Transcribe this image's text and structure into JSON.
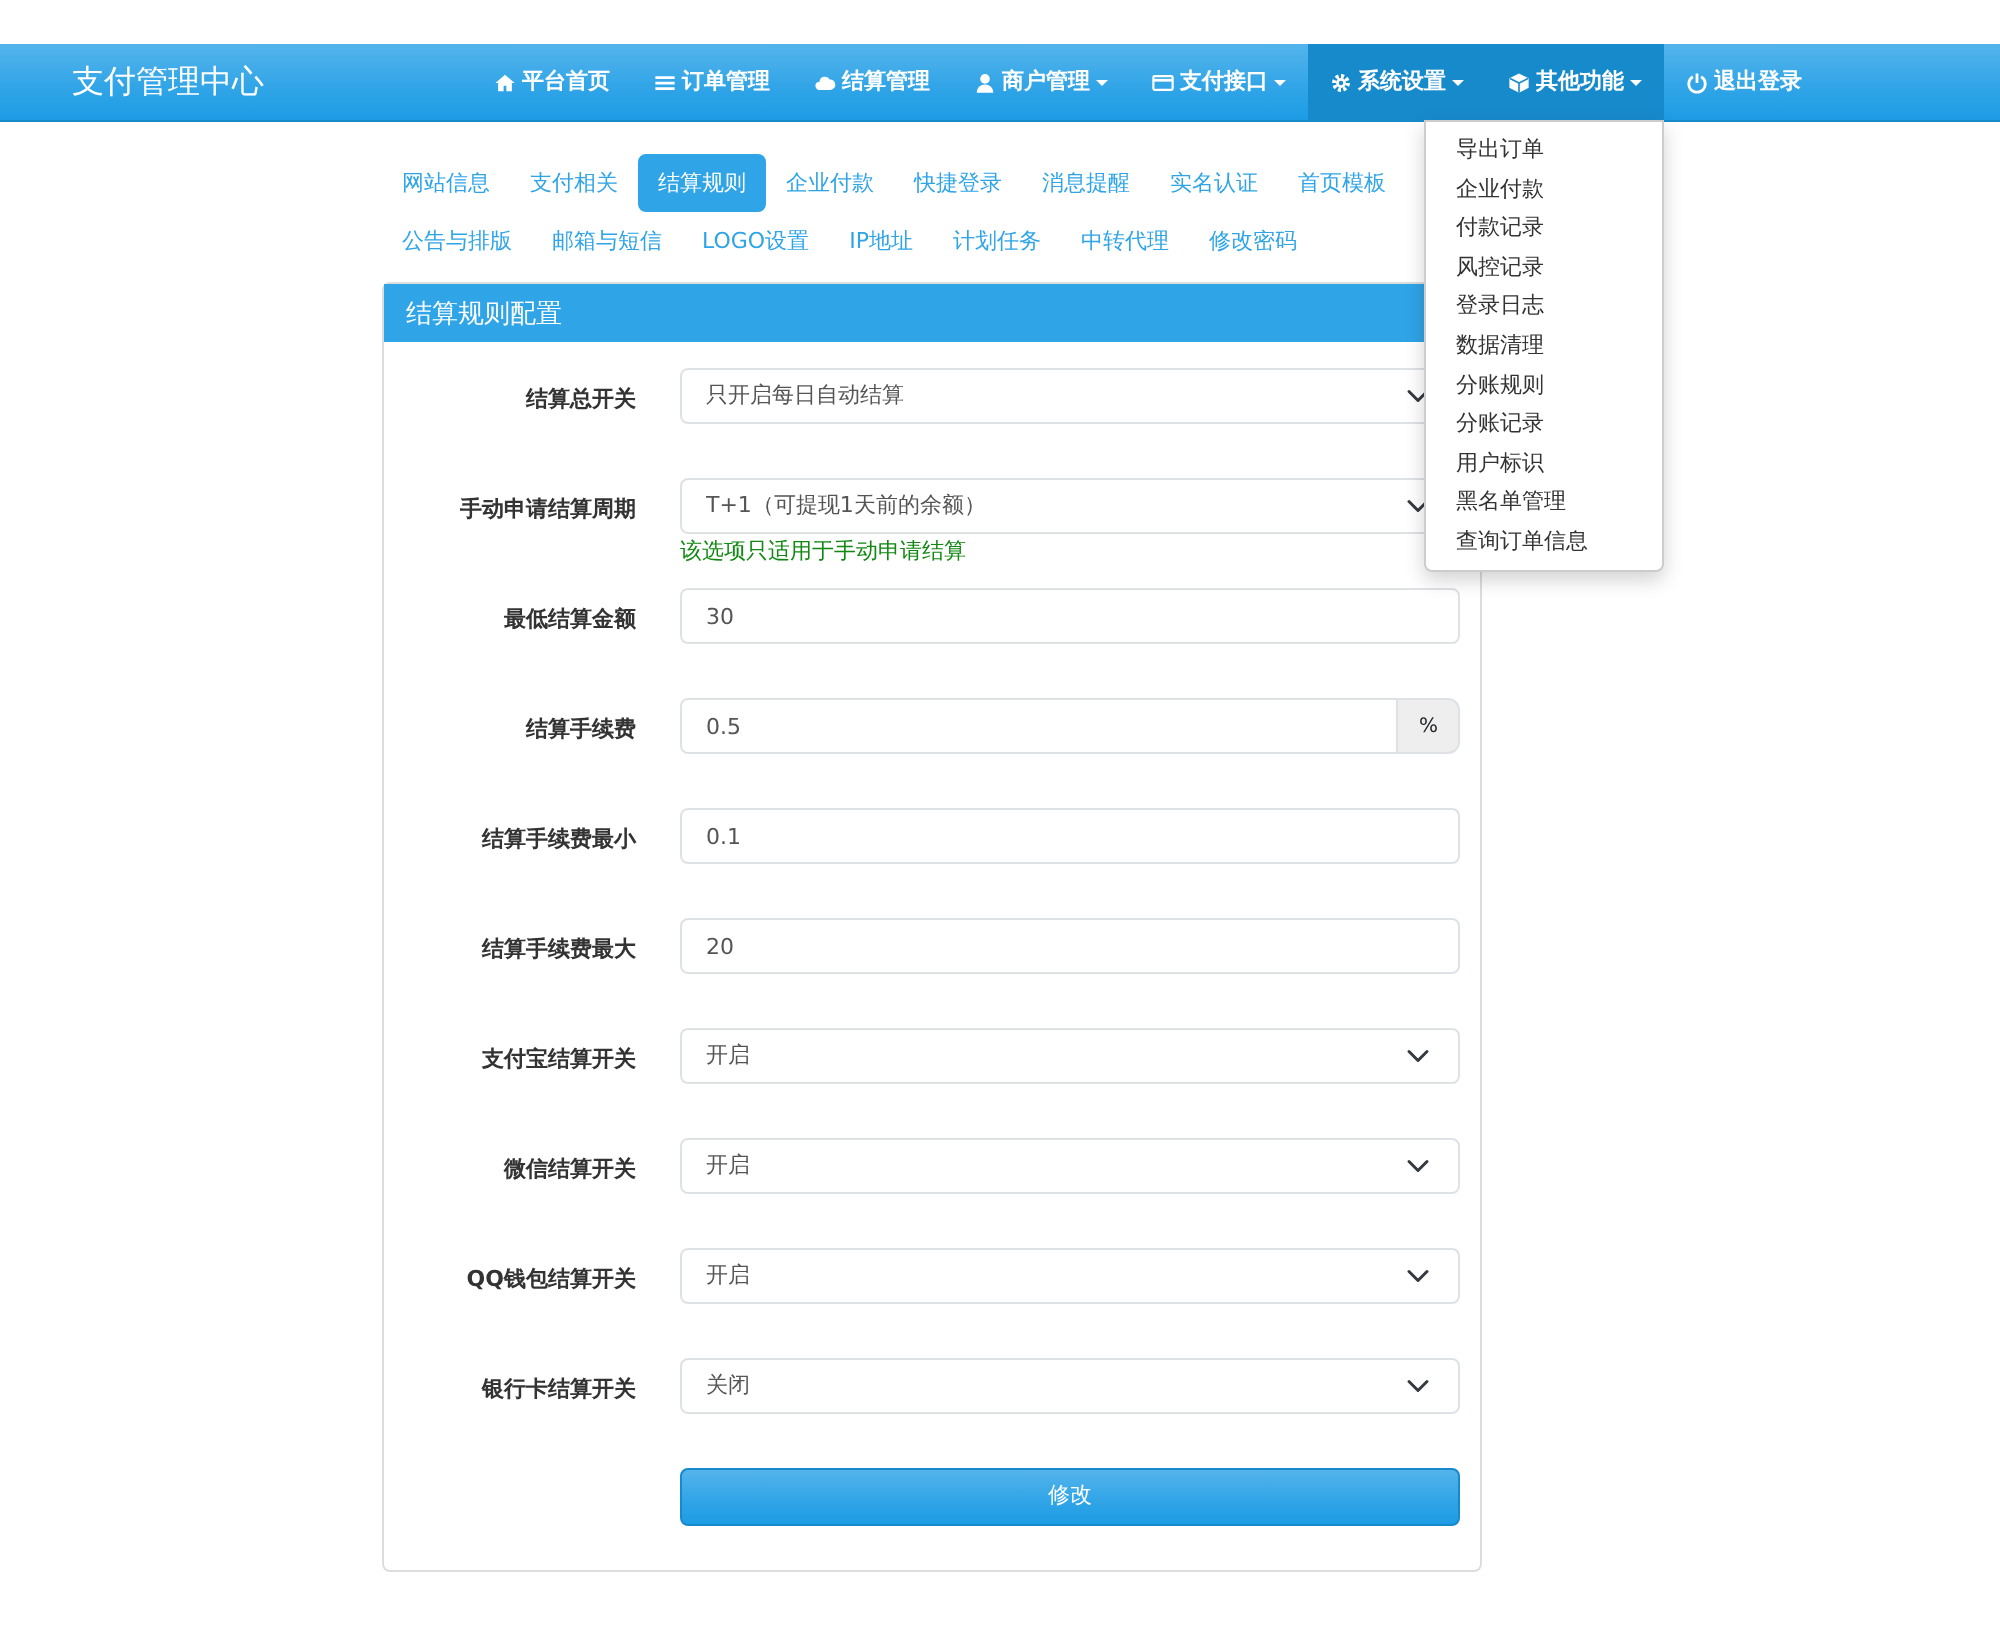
{
  "brand": "支付管理中心",
  "nav": [
    {
      "label": "平台首页",
      "dropdown": false,
      "active": false
    },
    {
      "label": "订单管理",
      "dropdown": false,
      "active": false
    },
    {
      "label": "结算管理",
      "dropdown": false,
      "active": false
    },
    {
      "label": "商户管理",
      "dropdown": true,
      "active": false
    },
    {
      "label": "支付接口",
      "dropdown": true,
      "active": false
    },
    {
      "label": "系统设置",
      "dropdown": true,
      "active": true
    },
    {
      "label": "其他功能",
      "dropdown": true,
      "active": true,
      "menu": [
        "导出订单",
        "企业付款",
        "付款记录",
        "风控记录",
        "登录日志",
        "数据清理",
        "分账规则",
        "分账记录",
        "用户标识",
        "黑名单管理",
        "查询订单信息"
      ]
    },
    {
      "label": "退出登录",
      "dropdown": false,
      "active": false
    }
  ],
  "tabs": [
    {
      "label": "网站信息",
      "selected": false
    },
    {
      "label": "支付相关",
      "selected": false
    },
    {
      "label": "结算规则",
      "selected": true
    },
    {
      "label": "企业付款",
      "selected": false
    },
    {
      "label": "快捷登录",
      "selected": false
    },
    {
      "label": "消息提醒",
      "selected": false
    },
    {
      "label": "实名认证",
      "selected": false
    },
    {
      "label": "首页模板",
      "selected": false
    },
    {
      "label": "公告与排版",
      "selected": false
    },
    {
      "label": "邮箱与短信",
      "selected": false
    },
    {
      "label": "LOGO设置",
      "selected": false
    },
    {
      "label": "IP地址",
      "selected": false
    },
    {
      "label": "计划任务",
      "selected": false
    },
    {
      "label": "中转代理",
      "selected": false
    },
    {
      "label": "修改密码",
      "selected": false
    }
  ],
  "panel": {
    "title": "结算规则配置",
    "fields": [
      {
        "kind": "select",
        "label": "结算总开关",
        "value": "只开启每日自动结算"
      },
      {
        "kind": "select",
        "label": "手动申请结算周期",
        "value": "T+1（可提现1天前的余额）",
        "help": "该选项只适用于手动申请结算"
      },
      {
        "kind": "input",
        "label": "最低结算金额",
        "value": "30"
      },
      {
        "kind": "addon",
        "label": "结算手续费",
        "value": "0.5",
        "addon": "%"
      },
      {
        "kind": "input",
        "label": "结算手续费最小",
        "value": "0.1"
      },
      {
        "kind": "input",
        "label": "结算手续费最大",
        "value": "20"
      },
      {
        "kind": "select",
        "label": "支付宝结算开关",
        "value": "开启"
      },
      {
        "kind": "select",
        "label": "微信结算开关",
        "value": "开启"
      },
      {
        "kind": "select",
        "label": "QQ钱包结算开关",
        "value": "开启"
      },
      {
        "kind": "select",
        "label": "银行卡结算开关",
        "value": "关闭"
      }
    ],
    "submit": "修改"
  }
}
